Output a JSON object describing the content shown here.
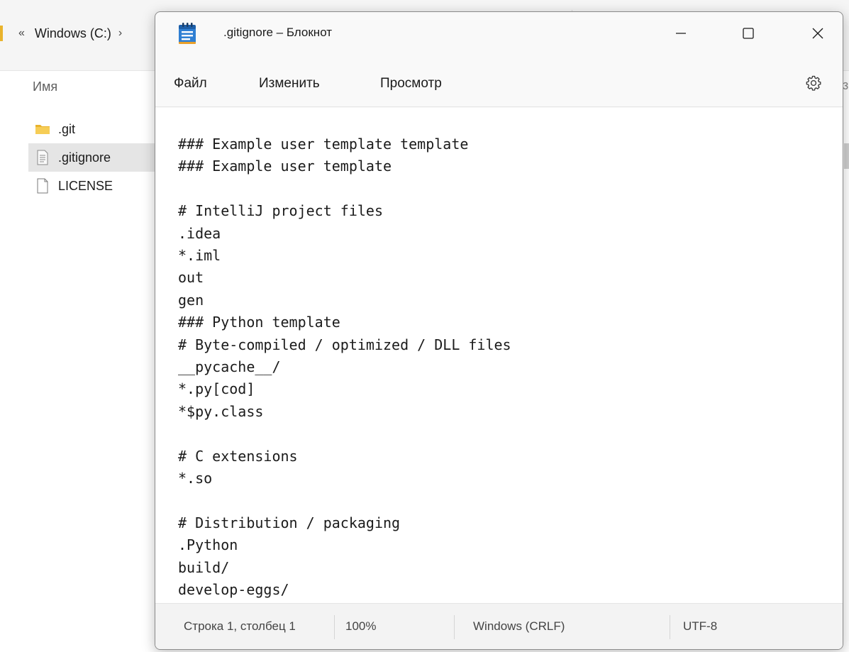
{
  "explorer": {
    "breadcrumb": {
      "chevron_left": "«",
      "drive": "Windows (C:)",
      "chevron_right": "›"
    },
    "column_header": "Имя",
    "files": [
      {
        "name": ".git",
        "icon": "folder-icon",
        "selected": false
      },
      {
        "name": ".gitignore",
        "icon": "text-file-icon",
        "selected": true
      },
      {
        "name": "LICENSE",
        "icon": "file-icon",
        "selected": false
      }
    ],
    "cut_off_text": "з"
  },
  "notepad": {
    "title": ".gitignore – Блокнот",
    "icon": "notepad-icon",
    "window_controls": [
      "minimize-icon",
      "maximize-icon",
      "close-icon"
    ],
    "menu": {
      "file": "Файл",
      "edit": "Изменить",
      "view": "Просмотр"
    },
    "settings_icon": "gear-icon",
    "content": "### Example user template template\n### Example user template\n\n# IntelliJ project files\n.idea\n*.iml\nout\ngen\n### Python template\n# Byte-compiled / optimized / DLL files\n__pycache__/\n*.py[cod]\n*$py.class\n\n# C extensions\n*.so\n\n# Distribution / packaging\n.Python\nbuild/\ndevelop-eggs/\ndist/",
    "status": {
      "position": "Строка 1, столбец 1",
      "zoom": "100%",
      "line_endings": "Windows (CRLF)",
      "encoding": "UTF-8"
    }
  },
  "colors": {
    "folder": "#e9b32c",
    "selection": "#e5e5e5",
    "window_border": "#8a8a8a"
  }
}
